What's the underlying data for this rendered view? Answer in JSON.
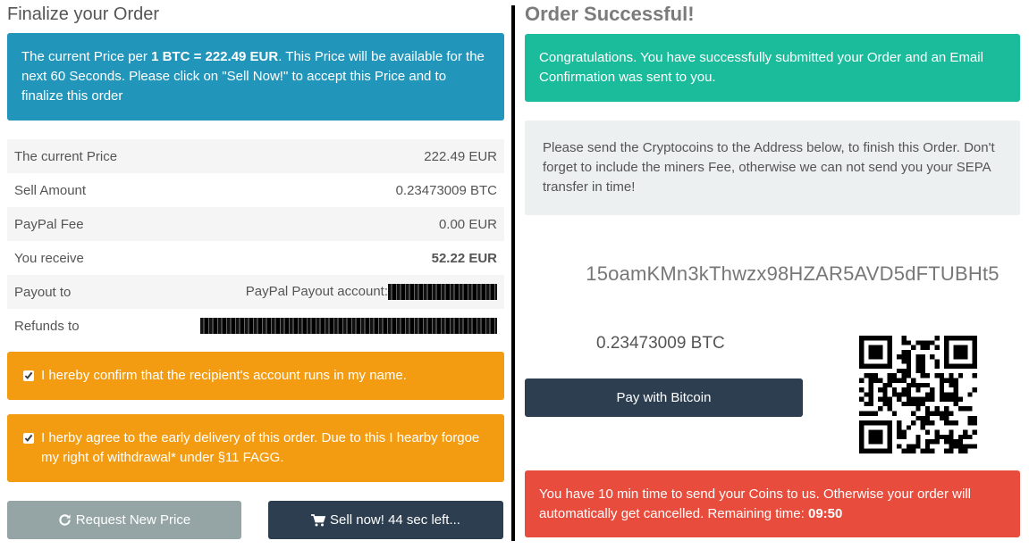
{
  "left": {
    "title": "Finalize your Order",
    "info": {
      "prefix": "The current Price per ",
      "price_strong": "1 BTC = 222.49 EUR",
      "suffix": ". This Price will be available for the next 60 Seconds. Please click on \"Sell Now!\" to accept this Price and to finalize this order"
    },
    "summary": [
      {
        "label": "The current Price",
        "value": "222.49 EUR"
      },
      {
        "label": "Sell Amount",
        "value": "0.23473009 BTC"
      },
      {
        "label": "PayPal Fee",
        "value": "0.00 EUR"
      },
      {
        "label": "You receive",
        "value": "52.22 EUR"
      },
      {
        "label": "Payout to",
        "value": "PayPal Payout account:"
      },
      {
        "label": "Refunds to",
        "value": ""
      }
    ],
    "confirm_account": "I hereby confirm that the recipient's account runs in my name.",
    "confirm_delivery": "I herby agree to the early delivery of this order. Due to this I hearby forgoe my right of withdrawal* under §11 FAGG.",
    "request_button": "Request New Price",
    "sell_button": "Sell now! 44 sec left..."
  },
  "right": {
    "title": "Order Successful!",
    "success": "Congratulations. You have successfully submitted your Order and an Email Confirmation was sent to you.",
    "instructions": "Please send the Cryptocoins to the Address below, to finish this Order. Don't forget to include the miners Fee, otherwise we can not send you your SEPA transfer in time!",
    "address": "15oamKMn3kThwzx98HZAR5AVD5dFTUBHt5",
    "amount": "0.23473009 BTC",
    "pay_button": "Pay with Bitcoin",
    "warning_text": "You have 10 min time to send your Coins to us. Otherwise your order will automatically get cancelled. Remaining time: ",
    "remaining_time": "09:50"
  },
  "colors": {
    "info": "#2295bb",
    "success": "#1abc9c",
    "warning": "#f39c12",
    "danger": "#e74c3c",
    "dark": "#2c3e50",
    "gray": "#95a5a6"
  },
  "icons": {
    "refresh": "refresh-icon",
    "cart": "cart-icon",
    "qr": "qr-code"
  }
}
